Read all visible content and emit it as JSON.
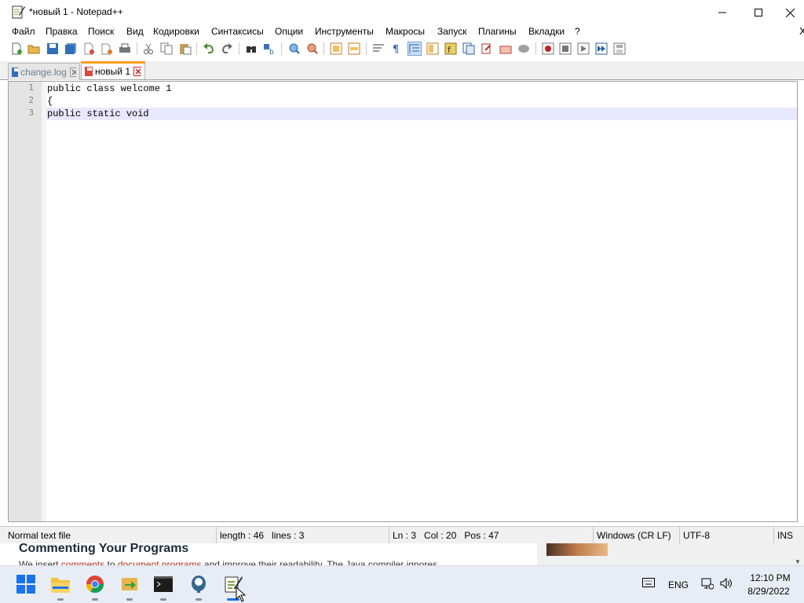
{
  "window": {
    "title": "*новый 1 - Notepad++"
  },
  "menu": {
    "items": [
      "Файл",
      "Правка",
      "Поиск",
      "Вид",
      "Кодировки",
      "Синтаксисы",
      "Опции",
      "Инструменты",
      "Макросы",
      "Запуск",
      "Плагины",
      "Вкладки",
      "?"
    ],
    "close_x": "X"
  },
  "toolbar": {
    "icons": [
      "new-file-icon",
      "open-file-icon",
      "save-icon",
      "save-all-icon",
      "close-icon",
      "close-all-icon",
      "print-icon",
      "cut-icon",
      "copy-icon",
      "paste-icon",
      "undo-icon",
      "redo-icon",
      "find-icon",
      "replace-icon",
      "zoom-in-icon",
      "zoom-out-icon",
      "sync-vertical-icon",
      "sync-horizontal-icon",
      "word-wrap-icon",
      "show-all-chars-icon",
      "indent-guide-icon",
      "doc-map-icon",
      "function-list-icon",
      "folder-workspace-icon",
      "doc-switcher-icon",
      "monitoring-icon",
      "record-macro-icon",
      "stop-recording-icon",
      "playback-macro-icon",
      "run-macro-multiple-icon",
      "save-macro-icon"
    ]
  },
  "tabs": [
    {
      "label": "change.log",
      "active": false
    },
    {
      "label": "новый 1",
      "active": true
    }
  ],
  "editor": {
    "lines": [
      {
        "number": "1",
        "text": "public class welcome 1"
      },
      {
        "number": "2",
        "text": "{"
      },
      {
        "number": "3",
        "text": "public static void"
      }
    ],
    "current_line": 3
  },
  "status": {
    "file_type": "Normal text file",
    "length": "length : 46",
    "lines": "lines : 3",
    "ln": "Ln : 3",
    "col": "Col : 20",
    "pos": "Pos : 47",
    "eol": "Windows (CR LF)",
    "encoding": "UTF-8",
    "mode": "INS"
  },
  "background_page": {
    "heading": "Commenting Your Programs",
    "text_before": "We insert ",
    "link1": "comments",
    "text_mid": " to ",
    "link2": "document programs",
    "text_after": " and improve their readability. The Java compiler ignores"
  },
  "taskbar": {
    "apps": [
      "start-icon",
      "file-explorer-icon",
      "chrome-icon",
      "app-icon",
      "terminal-icon",
      "postgres-icon",
      "notepadpp-icon"
    ],
    "language": "ENG",
    "time": "12:10 PM",
    "date": "8/29/2022"
  },
  "colors": {
    "accent_tab": "#f59f1c",
    "current_line": "#e8e8ff",
    "taskbar_active": "#1a73e8"
  }
}
